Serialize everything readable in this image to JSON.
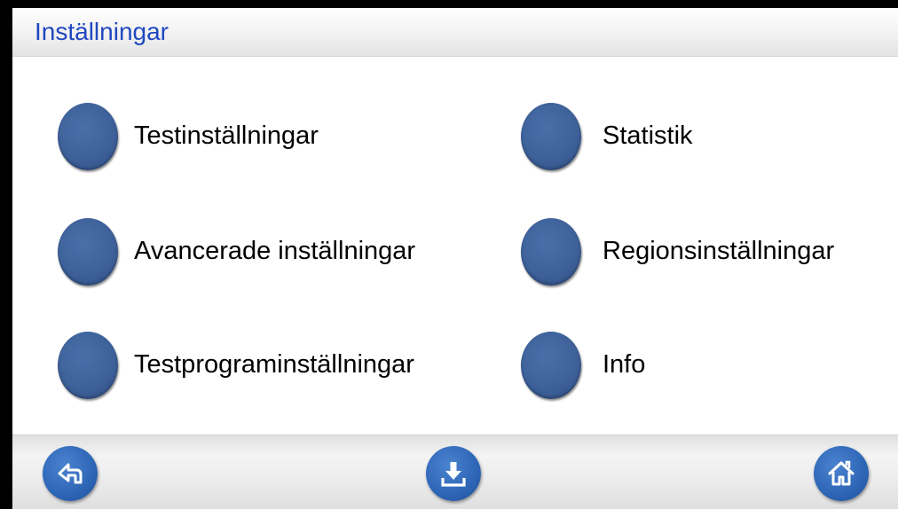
{
  "header": {
    "title": "Inställningar"
  },
  "menu": {
    "left": [
      {
        "label": "Testinställningar"
      },
      {
        "label": "Avancerade inställningar"
      },
      {
        "label": "Testprograminställningar"
      }
    ],
    "right": [
      {
        "label": "Statistik"
      },
      {
        "label": "Regionsinställningar"
      },
      {
        "label": "Info"
      }
    ]
  },
  "footer": {
    "buttons": [
      {
        "icon": "back-arrow-icon"
      },
      {
        "icon": "download-tray-icon"
      },
      {
        "icon": "home-icon"
      }
    ]
  },
  "colors": {
    "title_blue": "#1f48c0",
    "bullet_blue": "#3e619a",
    "footer_button_blue": "#2e66b6",
    "frame": "#000000"
  }
}
